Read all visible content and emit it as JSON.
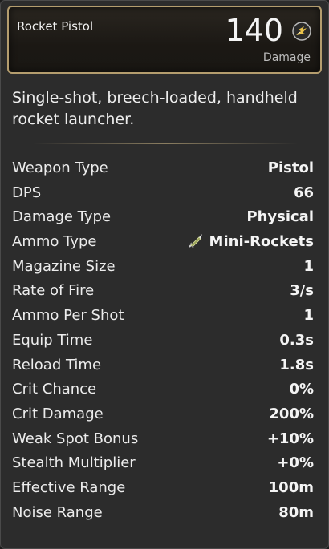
{
  "header": {
    "weapon_name": "Rocket Pistol",
    "damage_value": "140",
    "damage_label": "Damage",
    "damage_icon": "burst-icon",
    "accent_color": "#b49d6e"
  },
  "description": "Single-shot, breech-loaded, handheld rocket launcher.",
  "stats": [
    {
      "label": "Weapon Type",
      "value": "Pistol"
    },
    {
      "label": "DPS",
      "value": "66"
    },
    {
      "label": "Damage Type",
      "value": "Physical"
    },
    {
      "label": "Ammo Type",
      "value": "Mini-Rockets",
      "icon": "rocket-ammo-icon"
    },
    {
      "label": "Magazine Size",
      "value": "1"
    },
    {
      "label": "Rate of Fire",
      "value": "3/s"
    },
    {
      "label": "Ammo Per Shot",
      "value": "1"
    },
    {
      "label": "Equip Time",
      "value": "0.3s"
    },
    {
      "label": "Reload Time",
      "value": "1.8s"
    },
    {
      "label": "Crit Chance",
      "value": "0%"
    },
    {
      "label": "Crit Damage",
      "value": "200%"
    },
    {
      "label": "Weak Spot Bonus",
      "value": "+10%"
    },
    {
      "label": "Stealth Multiplier",
      "value": "+0%"
    },
    {
      "label": "Effective Range",
      "value": "100m"
    },
    {
      "label": "Noise Range",
      "value": "80m"
    }
  ]
}
